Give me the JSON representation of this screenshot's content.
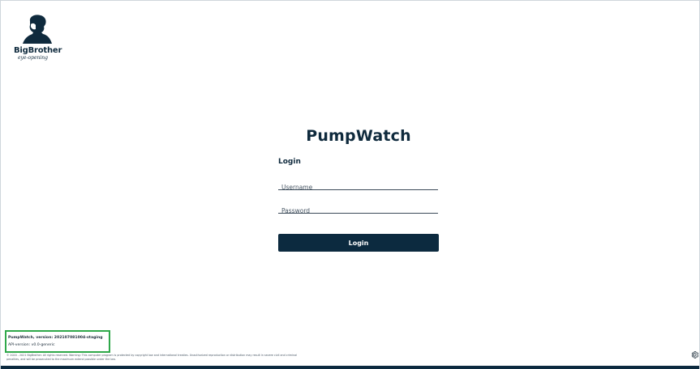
{
  "brand": {
    "name": "BigBrother",
    "tagline": "eye-opening"
  },
  "app": {
    "title": "PumpWatch"
  },
  "login": {
    "heading": "Login",
    "username_placeholder": "Username",
    "password_placeholder": "Password",
    "button_label": "Login"
  },
  "footer": {
    "version": "PumpWatch, version: 202107081004-staging",
    "api_version": "API-version: v0.0-generic",
    "copyright": "© 2020 - 2021 BigBrother. All rights reserved. Warning: This computer program is protected by copyright law and international treaties. Unauthorized reproduction or distribution may result in severe civil and criminal penalties, and will be prosecuted to the maximum extend possible under the law."
  },
  "icons": {
    "settings": "gear-icon",
    "logo": "profile-head-logo"
  },
  "colors": {
    "primary": "#0c2a3f",
    "highlight": "#2fa84a"
  }
}
